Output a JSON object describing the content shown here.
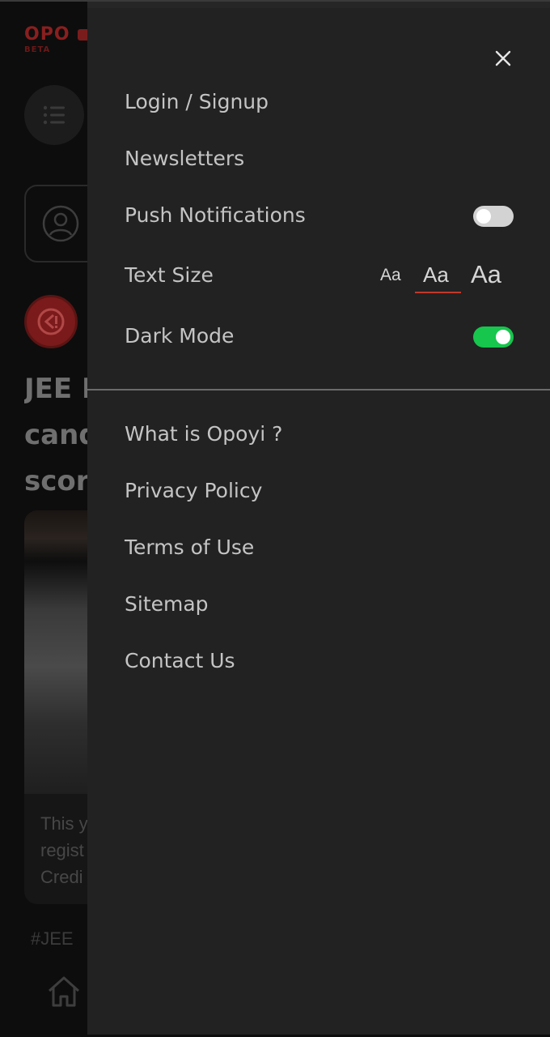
{
  "background": {
    "logo": {
      "text": "OPO",
      "beta": "BETA"
    },
    "headline_fragments": [
      "JEE M",
      "cand",
      "scor"
    ],
    "card_fragments": [
      "This y",
      "regist",
      "Credi"
    ],
    "tag": "#JEE"
  },
  "drawer": {
    "close_icon": "close-icon",
    "items": {
      "login": "Login / Signup",
      "newsletters": "Newsletters",
      "push": "Push Notifications",
      "text_size": "Text Size",
      "dark_mode": "Dark Mode"
    },
    "push_notifications_enabled": false,
    "dark_mode_enabled": true,
    "text_size_options": [
      "Aa",
      "Aa",
      "Aa"
    ],
    "text_size_selected_index": 1,
    "links": {
      "about": "What is Opoyi ?",
      "privacy": "Privacy Policy",
      "terms": "Terms of Use",
      "sitemap": "Sitemap",
      "contact": "Contact Us"
    }
  },
  "colors": {
    "drawer_bg": "#222222",
    "toggle_on": "#16c64d",
    "toggle_off": "#d3d3d3",
    "accent": "#c0392b"
  }
}
